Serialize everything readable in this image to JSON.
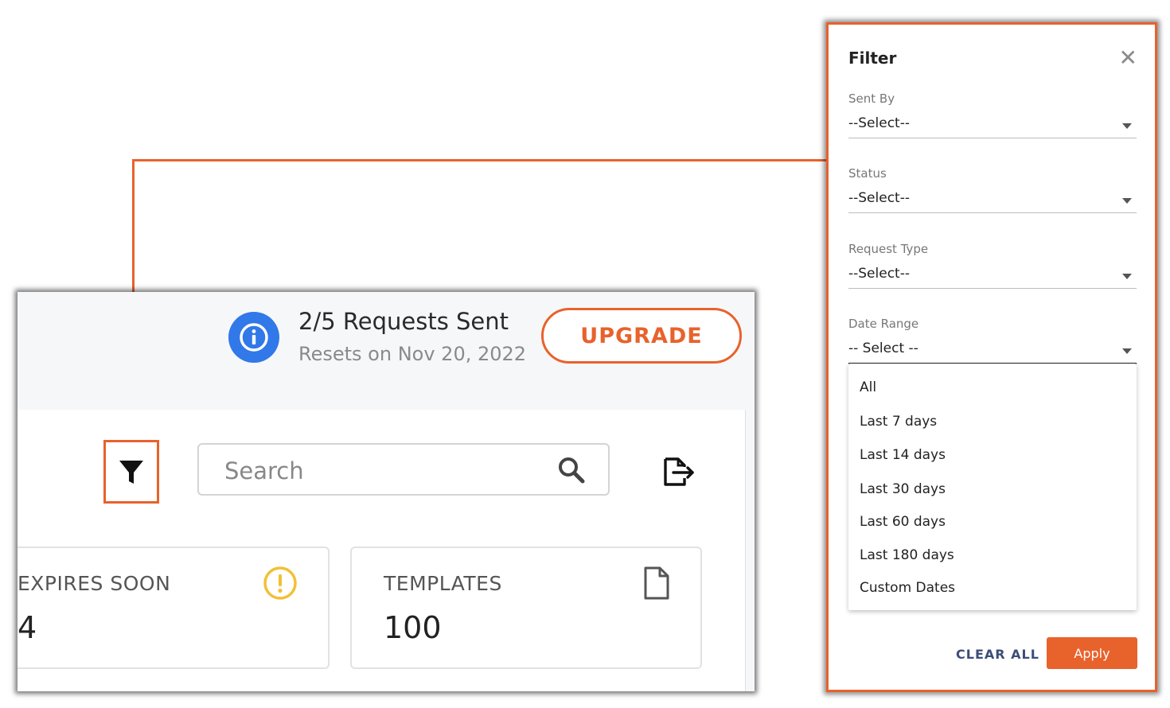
{
  "requests": {
    "title": "2/5 Requests Sent",
    "reset": "Resets on Nov 20, 2022"
  },
  "upgrade_label": "UPGRADE",
  "search": {
    "placeholder": "Search"
  },
  "cards": {
    "expires": {
      "label": "EXPIRES SOON",
      "value": "4"
    },
    "templates": {
      "label": "TEMPLATES",
      "value": "100"
    }
  },
  "filter_panel": {
    "title": "Filter",
    "close": "✕",
    "fields": [
      {
        "label": "Sent By",
        "value": "--Select--"
      },
      {
        "label": "Status",
        "value": "--Select--"
      },
      {
        "label": "Request Type",
        "value": "--Select--"
      },
      {
        "label": "Date Range",
        "value": "-- Select --"
      }
    ],
    "date_options": [
      "All",
      "Last 7 days",
      "Last 14 days",
      "Last 30 days",
      "Last 60 days",
      "Last 180 days",
      "Custom Dates"
    ],
    "clear_label": "CLEAR ALL",
    "apply_label": "Apply"
  },
  "colors": {
    "accent": "#e8622c",
    "info_blue": "#3178e8",
    "warning": "#f2c037",
    "link_blue": "#3c4e78"
  }
}
